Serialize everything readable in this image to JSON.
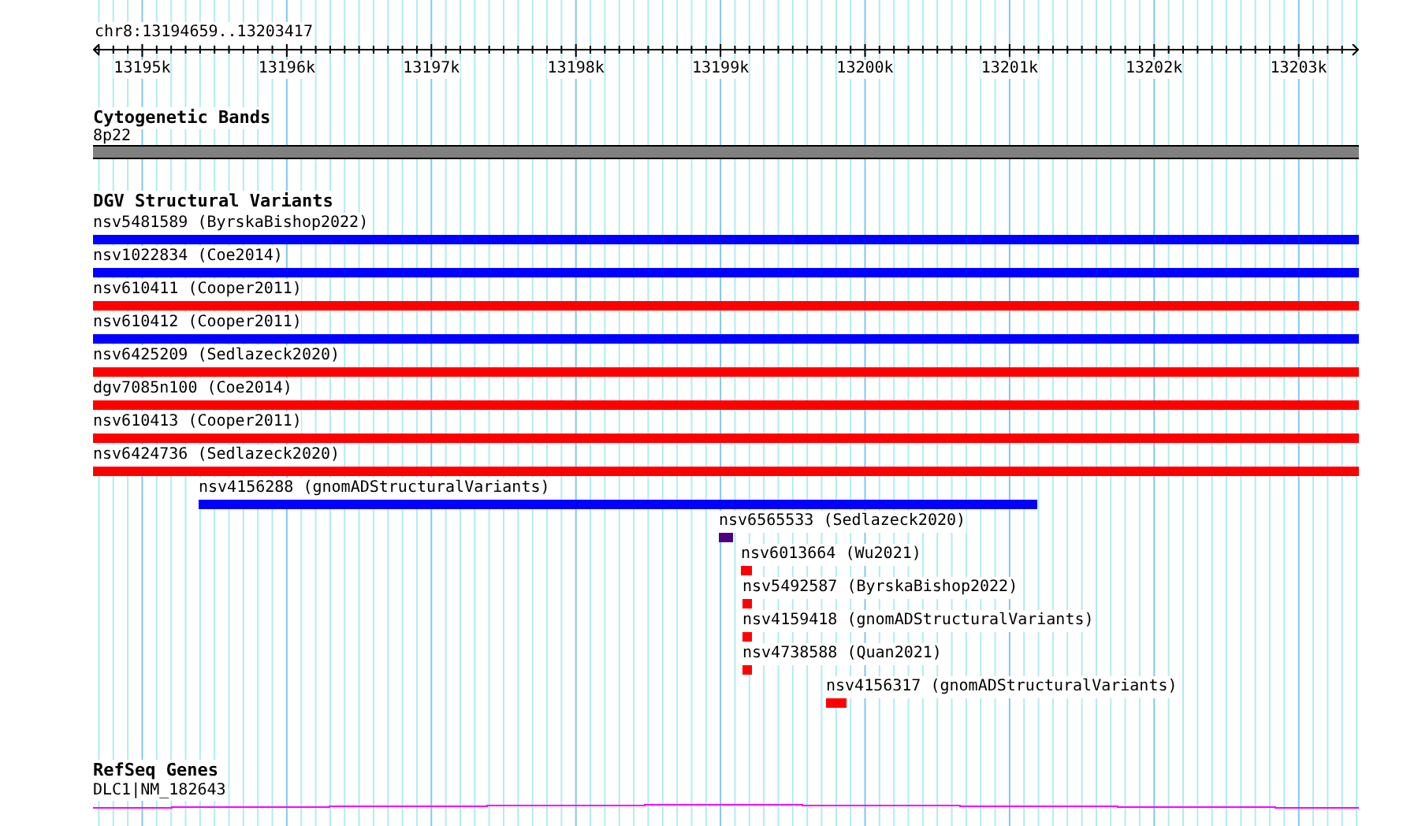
{
  "ruler": {
    "region": "chr8:13194659..13203417",
    "ticks": [
      {
        "label": "13195k",
        "level": 0.0389
      },
      {
        "label": "13196k",
        "level": 0.1531
      },
      {
        "label": "13197k",
        "level": 0.2673
      },
      {
        "label": "13198k",
        "level": 0.3815
      },
      {
        "label": "13199k",
        "level": 0.4957
      },
      {
        "label": "13200k",
        "level": 0.6099
      },
      {
        "label": "13201k",
        "level": 0.7241
      },
      {
        "label": "13202k",
        "level": 0.8382
      },
      {
        "label": "13203k",
        "level": 0.9524
      }
    ]
  },
  "cytogenetic_bands": {
    "title": "Cytogenetic Bands",
    "band": "8p22",
    "color": "#808080"
  },
  "dgv": {
    "title": "DGV Structural Variants",
    "features": [
      {
        "kind": "spanning",
        "label": "nsv5481589 (ByrskaBishop2022)",
        "color": "#0000ff"
      },
      {
        "kind": "spanning",
        "label": "nsv1022834 (Coe2014)",
        "color": "#0000ff"
      },
      {
        "kind": "spanning",
        "label": "nsv610411 (Cooper2011)",
        "color": "#ff0000"
      },
      {
        "kind": "spanning",
        "label": "nsv610412 (Cooper2011)",
        "color": "#0000ff"
      },
      {
        "kind": "spanning",
        "label": "nsv6425209 (Sedlazeck2020)",
        "color": "#ff0000"
      },
      {
        "kind": "spanning",
        "label": "dgv7085n100 (Coe2014)",
        "color": "#ff0000"
      },
      {
        "kind": "spanning",
        "label": "nsv610413 (Cooper2011)",
        "color": "#ff0000"
      },
      {
        "kind": "spanning",
        "label": "nsv6424736 (Sedlazeck2020)",
        "color": "#ff0000"
      },
      {
        "kind": "partial",
        "label": "nsv4156288 (gnomADStructuralVariants)",
        "color": "#0000ff"
      },
      {
        "kind": "partial",
        "label": "nsv6565533 (Sedlazeck2020)",
        "color": "#4b0082"
      },
      {
        "kind": "partial",
        "label": "nsv6013664 (Wu2021)",
        "color": "#ff0000"
      },
      {
        "kind": "partial",
        "label": "nsv5492587 (ByrskaBishop2022)",
        "color": "#ff0000"
      },
      {
        "kind": "partial",
        "label": "nsv4159418 (gnomADStructuralVariants)",
        "color": "#ff0000"
      },
      {
        "kind": "partial",
        "label": "nsv4738588 (Quan2021)",
        "color": "#ff0000"
      },
      {
        "kind": "partial",
        "label": "nsv4156317 (gnomADStructuralVariants)",
        "color": "#ff0000"
      }
    ]
  },
  "refseq": {
    "title": "RefSeq Genes",
    "gene": "DLC1|NM_182643",
    "color": "#ff00ff"
  }
}
